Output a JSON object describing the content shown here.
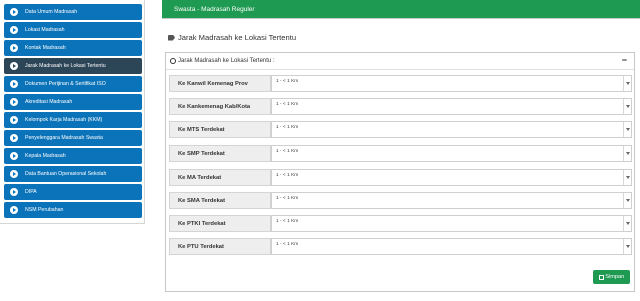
{
  "sidebar": {
    "items": [
      {
        "label": "Data Umum Madrasah"
      },
      {
        "label": "Lokasi Madrasah"
      },
      {
        "label": "Kontak Madrasah"
      },
      {
        "label": "Jarak Madrasah ke Lokasi Tertentu",
        "active": true
      },
      {
        "label": "Dokumen Perijinan & Sertifikat ISO"
      },
      {
        "label": "Akreditasi Madrasah"
      },
      {
        "label": "Kelompok Karja Madrasah (KKM)"
      },
      {
        "label": "Penyelenggara Madrasah Swasta"
      },
      {
        "label": "Kepala Madrasah"
      },
      {
        "label": "Data Bantuan Operasional Sekolah"
      },
      {
        "label": "DIPA"
      },
      {
        "label": "NSM Perubahan"
      }
    ]
  },
  "banner": {
    "text": "Swasta - Madrasah Reguler"
  },
  "section": {
    "title": "Jarak Madrasah ke Lokasi Tertentu"
  },
  "panel": {
    "heading": "Jarak Madrasah ke Lokasi Tertentu :",
    "collapse_symbol": "−",
    "rows": [
      {
        "label": "Ke Kanwil Kemenag Prov",
        "value": "1 - < 1 Km"
      },
      {
        "label": "Ke Kankemenag Kab/Kota",
        "value": "1 - < 1 Km"
      },
      {
        "label": "Ke MTS Terdekat",
        "value": "1 - < 1 Km"
      },
      {
        "label": "Ke SMP Terdekat",
        "value": "1 - < 1 Km"
      },
      {
        "label": "Ke MA Terdekat",
        "value": "1 - < 1 Km"
      },
      {
        "label": "Ke SMA Terdekat",
        "value": "1 - < 1 Km"
      },
      {
        "label": "Ke PTKI Terdekat",
        "value": "1 - < 1 Km"
      },
      {
        "label": "Ke PTU Terdekat",
        "value": "1 - < 1 Km"
      }
    ],
    "save_label": "Simpan"
  },
  "colors": {
    "sidebar_blue": "#0b73b9",
    "sidebar_active": "#2c4557",
    "green": "#1f9a52"
  }
}
